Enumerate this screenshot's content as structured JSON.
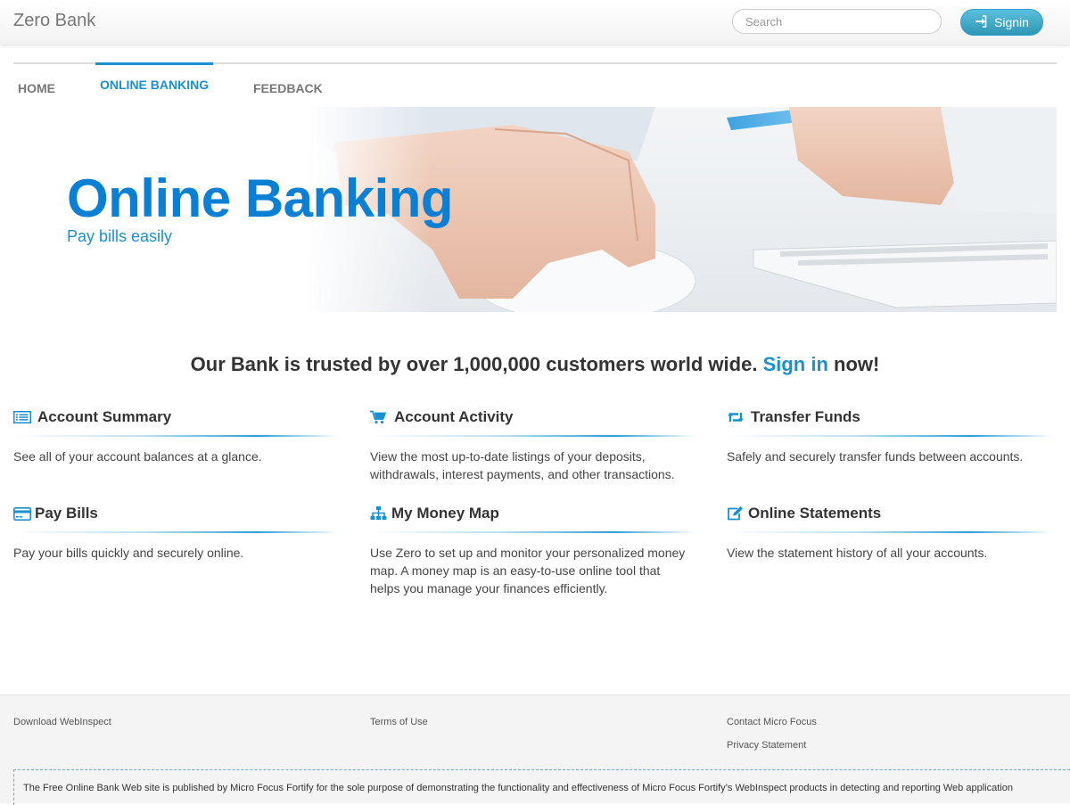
{
  "app": {
    "brand": "Zero Bank"
  },
  "header": {
    "search_placeholder": "Search",
    "signin_label": "Signin",
    "accent_color": "#2f96b4"
  },
  "nav": {
    "tabs": [
      {
        "label": "HOME",
        "active": false
      },
      {
        "label": "ONLINE BANKING",
        "active": true
      },
      {
        "label": "FEEDBACK",
        "active": false
      }
    ]
  },
  "hero": {
    "title": "Online Banking",
    "subtitle": "Pay bills easily",
    "title_color": "#0a7fd4"
  },
  "trusted": {
    "prefix": "Our Bank is trusted by over 1,000,000 customers world wide.",
    "link": "Sign in",
    "suffix": "now!"
  },
  "features": [
    {
      "icon": "list-icon",
      "title": "Account Summary",
      "desc": "See all of your account balances at a glance."
    },
    {
      "icon": "cart-icon",
      "title": "Account Activity",
      "desc": "View the most up-to-date listings of your deposits, withdrawals, interest payments, and other transactions."
    },
    {
      "icon": "retweet-icon",
      "title": "Transfer Funds",
      "desc": "Safely and securely transfer funds between accounts."
    },
    {
      "icon": "credit-card-icon",
      "title": "Pay Bills",
      "desc": "Pay your bills quickly and securely online."
    },
    {
      "icon": "sitemap-icon",
      "title": "My Money Map",
      "desc": "Use Zero to set up and monitor your personalized money map. A money map is an easy-to-use online tool that helps you manage your finances efficiently."
    },
    {
      "icon": "edit-icon",
      "title": "Online Statements",
      "desc": "View the statement history of all your accounts."
    }
  ],
  "footer": {
    "download": "Download WebInspect",
    "terms": "Terms of Use",
    "contact": "Contact Micro Focus",
    "privacy": "Privacy Statement",
    "disclaimer": "The Free Online Bank Web site is published by Micro Focus Fortify for the sole purpose of demonstrating the functionality and effectiveness of Micro Focus Fortify’s WebInspect products in detecting and reporting Web application"
  }
}
